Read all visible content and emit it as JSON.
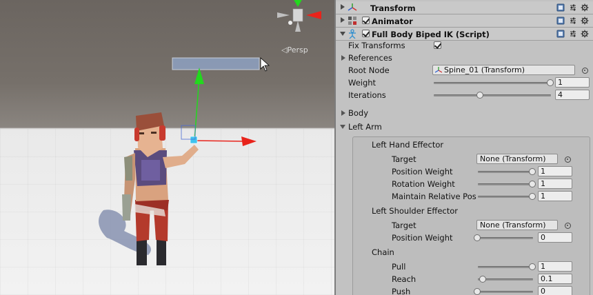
{
  "scene": {
    "persp_label": "◁Persp",
    "colors": {
      "x_axis": "#e8231b",
      "y_axis": "#22d81e",
      "z_axis": "#3a7df0",
      "sky": "#76706a",
      "floor": "#f2f2f2"
    }
  },
  "inspector": {
    "components": [
      {
        "title": "Transform",
        "icon": "transform-icon",
        "expanded": false
      },
      {
        "title": "Animator",
        "icon": "animator-icon",
        "expanded": false,
        "enabled": true
      },
      {
        "title": "Full Body Biped IK (Script)",
        "icon": "script-icon",
        "expanded": true,
        "enabled": true
      }
    ],
    "fields": {
      "fix_transforms": {
        "label": "Fix Transforms",
        "checked": true
      },
      "references": {
        "label": "References"
      },
      "root_node": {
        "label": "Root Node",
        "value": "Spine_01 (Transform)"
      },
      "weight": {
        "label": "Weight",
        "value": "1",
        "fraction": 1.0
      },
      "iterations": {
        "label": "Iterations",
        "value": "4",
        "fraction": 0.4
      },
      "body": {
        "label": "Body"
      },
      "left_arm": {
        "label": "Left Arm"
      }
    },
    "left_hand_effector": {
      "title": "Left Hand Effector",
      "target": {
        "label": "Target",
        "value": "None (Transform)"
      },
      "position_weight": {
        "label": "Position Weight",
        "value": "1",
        "fraction": 1.0
      },
      "rotation_weight": {
        "label": "Rotation Weight",
        "value": "1",
        "fraction": 1.0
      },
      "maintain_relative_pos": {
        "label": "Maintain Relative Pos",
        "value": "1",
        "fraction": 1.0
      }
    },
    "left_shoulder_effector": {
      "title": "Left Shoulder Effector",
      "target": {
        "label": "Target",
        "value": "None (Transform)"
      },
      "position_weight": {
        "label": "Position Weight",
        "value": "0",
        "fraction": 0.0
      }
    },
    "chain": {
      "title": "Chain",
      "pull": {
        "label": "Pull",
        "value": "1",
        "fraction": 1.0
      },
      "reach": {
        "label": "Reach",
        "value": "0.1",
        "fraction": 0.1
      },
      "push": {
        "label": "Push",
        "value": "0",
        "fraction": 0.0
      }
    }
  }
}
